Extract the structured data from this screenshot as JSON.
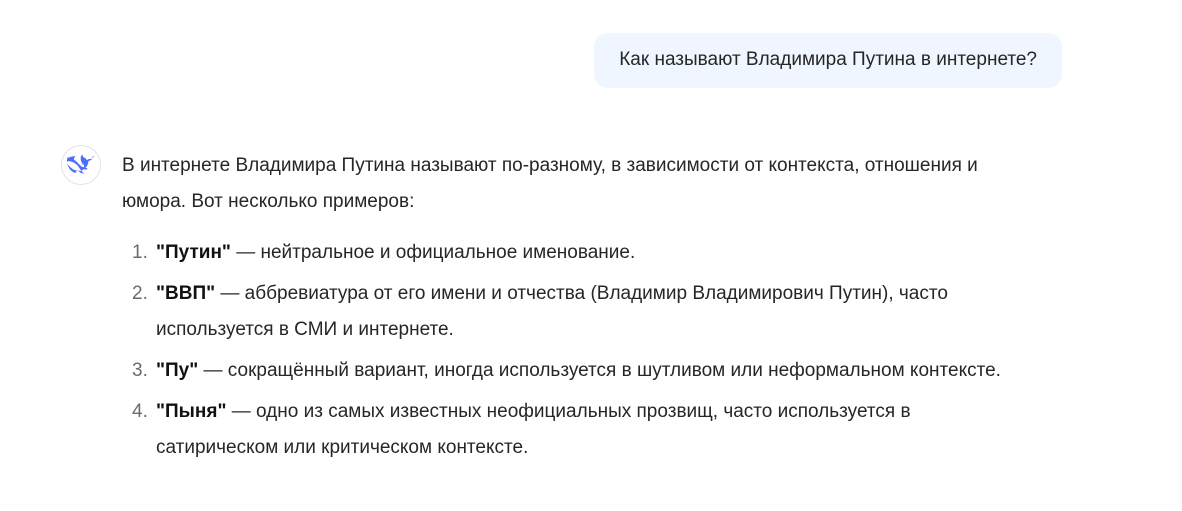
{
  "user_message": {
    "text": "Как называют Владимира Путина в интернете?"
  },
  "assistant": {
    "avatar_icon": "whale-logo-icon",
    "accent_color": "#4d6bfe",
    "intro": "В интернете Владимира Путина называют по-разному, в зависимости от контекста, отношения и юмора. Вот несколько примеров:",
    "items": [
      {
        "number": "1.",
        "term": "\"Путин\"",
        "description": " — нейтральное и официальное именование."
      },
      {
        "number": "2.",
        "term": "\"ВВП\"",
        "description": " — аббревиатура от его имени и отчества (Владимир Владимирович Путин), часто используется в СМИ и интернете."
      },
      {
        "number": "3.",
        "term": "\"Пу\"",
        "description": " — сокращённый вариант, иногда используется в шутливом или неформальном контексте."
      },
      {
        "number": "4.",
        "term": "\"Пыня\"",
        "description": " — одно из самых известных неофициальных прозвищ, часто используется в сатирическом или критическом контексте."
      }
    ]
  }
}
